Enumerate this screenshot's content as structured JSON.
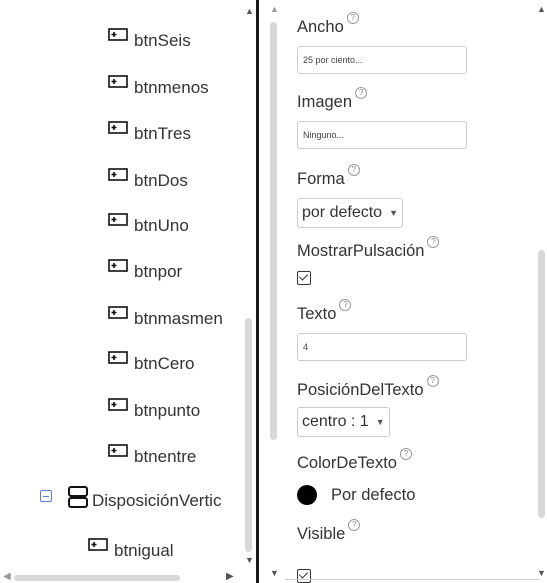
{
  "tree": {
    "items": [
      {
        "label": "btnSeis",
        "icon": "button-icon"
      },
      {
        "label": "btnmenos",
        "icon": "button-icon"
      },
      {
        "label": "btnTres",
        "icon": "button-icon"
      },
      {
        "label": "btnDos",
        "icon": "button-icon"
      },
      {
        "label": "btnUno",
        "icon": "button-icon"
      },
      {
        "label": "btnpor",
        "icon": "button-icon"
      },
      {
        "label": "btnmasmen",
        "icon": "button-icon"
      },
      {
        "label": "btnCero",
        "icon": "button-icon"
      },
      {
        "label": "btnpunto",
        "icon": "button-icon"
      },
      {
        "label": "btnentre",
        "icon": "button-icon"
      }
    ],
    "container": {
      "label": "DisposiciónVertic",
      "icon": "vertical-arrangement-icon",
      "collapse_icon": "collapse-minus-icon"
    },
    "child": {
      "label": "btnigual",
      "icon": "button-icon"
    }
  },
  "properties": {
    "ancho": {
      "label": "Ancho",
      "value": "25 por ciento..."
    },
    "imagen": {
      "label": "Imagen",
      "value": "Ninguno..."
    },
    "forma": {
      "label": "Forma",
      "value": "por defecto"
    },
    "mostrar_pulsacion": {
      "label": "MostrarPulsación",
      "checked": true
    },
    "texto": {
      "label": "Texto",
      "value": "4"
    },
    "posicion_texto": {
      "label": "PosiciónDelTexto",
      "value": "centro : 1"
    },
    "color_texto": {
      "label": "ColorDeTexto",
      "value": "Por defecto",
      "color": "#000000"
    },
    "visible": {
      "label": "Visible",
      "checked": true
    }
  },
  "help_glyph": "?"
}
